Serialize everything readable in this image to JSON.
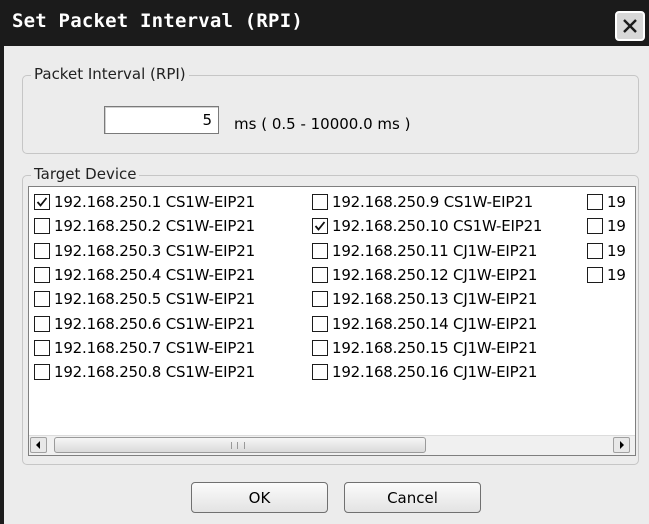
{
  "dialog": {
    "title": "Set Packet Interval (RPI)",
    "close_glyph": "×"
  },
  "packet_interval": {
    "legend": "Packet Interval (RPI)",
    "value": "5",
    "range_text": "ms ( 0.5 - 10000.0 ms )"
  },
  "target_device": {
    "legend": "Target Device",
    "devices": [
      {
        "label": "192.168.250.1 CS1W-EIP21",
        "checked": true
      },
      {
        "label": "192.168.250.2 CS1W-EIP21",
        "checked": false
      },
      {
        "label": "192.168.250.3 CS1W-EIP21",
        "checked": false
      },
      {
        "label": "192.168.250.4 CS1W-EIP21",
        "checked": false
      },
      {
        "label": "192.168.250.5 CS1W-EIP21",
        "checked": false
      },
      {
        "label": "192.168.250.6 CS1W-EIP21",
        "checked": false
      },
      {
        "label": "192.168.250.7 CS1W-EIP21",
        "checked": false
      },
      {
        "label": "192.168.250.8 CS1W-EIP21",
        "checked": false
      },
      {
        "label": "192.168.250.9 CS1W-EIP21",
        "checked": false
      },
      {
        "label": "192.168.250.10 CS1W-EIP21",
        "checked": true
      },
      {
        "label": "192.168.250.11 CJ1W-EIP21",
        "checked": false
      },
      {
        "label": "192.168.250.12 CJ1W-EIP21",
        "checked": false
      },
      {
        "label": "192.168.250.13 CJ1W-EIP21",
        "checked": false
      },
      {
        "label": "192.168.250.14 CJ1W-EIP21",
        "checked": false
      },
      {
        "label": "192.168.250.15 CJ1W-EIP21",
        "checked": false
      },
      {
        "label": "192.168.250.16 CJ1W-EIP21",
        "checked": false
      },
      {
        "label": "19",
        "checked": false
      },
      {
        "label": "19",
        "checked": false
      },
      {
        "label": "19",
        "checked": false
      },
      {
        "label": "19",
        "checked": false
      }
    ]
  },
  "buttons": {
    "ok": "OK",
    "cancel": "Cancel"
  },
  "icons": {
    "close": "close-icon",
    "checkbox": "checkbox-icon",
    "scroll_left": "arrow-left-icon",
    "scroll_right": "arrow-right-icon"
  }
}
